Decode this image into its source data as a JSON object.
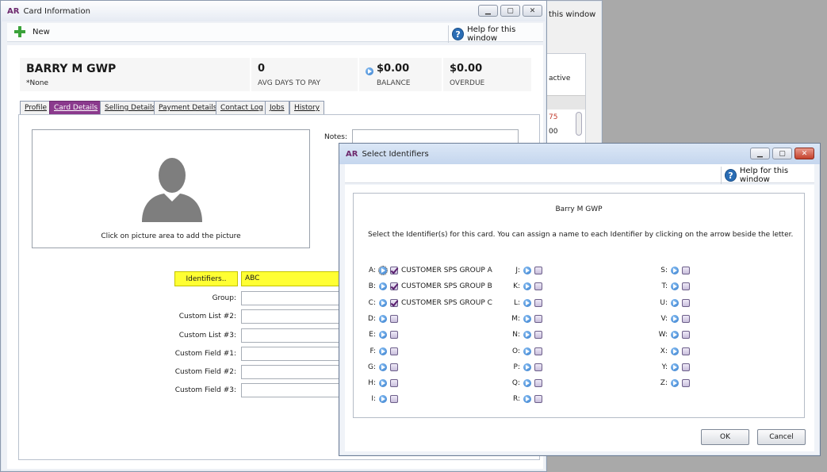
{
  "background_window": {
    "help_text": "this window",
    "active_text": "active",
    "cells": [
      "75",
      "00"
    ]
  },
  "card_window": {
    "app_logo": "AR",
    "title": "Card Information",
    "new_label": "New",
    "help_label": "Help for this window",
    "customer": {
      "name": "BARRY M GWP",
      "sub": "*None"
    },
    "stats": [
      {
        "value": "0",
        "label": "AVG DAYS TO PAY"
      },
      {
        "value": "$0.00",
        "label": "BALANCE"
      },
      {
        "value": "$0.00",
        "label": "OVERDUE"
      }
    ],
    "tabs": [
      "Profile",
      "Card Details",
      "Selling Details",
      "Payment Details",
      "Contact Log",
      "Jobs",
      "History"
    ],
    "active_tab": "Card Details",
    "picture_hint": "Click on picture area to add the picture",
    "notes_label": "Notes:",
    "identifiers_button": "Identifiers..",
    "identifiers_value": "ABC",
    "fields": [
      {
        "label": "Group:",
        "value": ""
      },
      {
        "label": "Custom List #2:",
        "value": ""
      },
      {
        "label": "Custom List #3:",
        "value": ""
      },
      {
        "label": "Custom Field #1:",
        "value": ""
      },
      {
        "label": "Custom Field #2:",
        "value": ""
      },
      {
        "label": "Custom Field #3:",
        "value": ""
      }
    ]
  },
  "identifiers_dialog": {
    "app_logo": "AR",
    "title": "Select Identifiers",
    "help_label": "Help for this window",
    "card_name": "Barry M GWP",
    "instructions": "Select the Identifier(s) for this card. You can assign a name to each Identifier by clicking on the arrow beside the letter.",
    "columns": [
      [
        {
          "letter": "A:",
          "checked": true,
          "name": "CUSTOMER SPS GROUP A"
        },
        {
          "letter": "B:",
          "checked": true,
          "name": "CUSTOMER SPS GROUP B"
        },
        {
          "letter": "C:",
          "checked": true,
          "name": "CUSTOMER SPS GROUP C"
        },
        {
          "letter": "D:",
          "checked": false,
          "name": ""
        },
        {
          "letter": "E:",
          "checked": false,
          "name": ""
        },
        {
          "letter": "F:",
          "checked": false,
          "name": ""
        },
        {
          "letter": "G:",
          "checked": false,
          "name": ""
        },
        {
          "letter": "H:",
          "checked": false,
          "name": ""
        },
        {
          "letter": "I:",
          "checked": false,
          "name": ""
        }
      ],
      [
        {
          "letter": "J:",
          "checked": false,
          "name": ""
        },
        {
          "letter": "K:",
          "checked": false,
          "name": ""
        },
        {
          "letter": "L:",
          "checked": false,
          "name": ""
        },
        {
          "letter": "M:",
          "checked": false,
          "name": ""
        },
        {
          "letter": "N:",
          "checked": false,
          "name": ""
        },
        {
          "letter": "O:",
          "checked": false,
          "name": ""
        },
        {
          "letter": "P:",
          "checked": false,
          "name": ""
        },
        {
          "letter": "Q:",
          "checked": false,
          "name": ""
        },
        {
          "letter": "R:",
          "checked": false,
          "name": ""
        }
      ],
      [
        {
          "letter": "S:",
          "checked": false,
          "name": ""
        },
        {
          "letter": "T:",
          "checked": false,
          "name": ""
        },
        {
          "letter": "U:",
          "checked": false,
          "name": ""
        },
        {
          "letter": "V:",
          "checked": false,
          "name": ""
        },
        {
          "letter": "W:",
          "checked": false,
          "name": ""
        },
        {
          "letter": "X:",
          "checked": false,
          "name": ""
        },
        {
          "letter": "Y:",
          "checked": false,
          "name": ""
        },
        {
          "letter": "Z:",
          "checked": false,
          "name": ""
        }
      ]
    ],
    "ok_label": "OK",
    "cancel_label": "Cancel"
  },
  "colors": {
    "accent_purple": "#8b3a8d",
    "highlight_yellow": "#ffff33",
    "help_blue": "#2a6db5"
  }
}
